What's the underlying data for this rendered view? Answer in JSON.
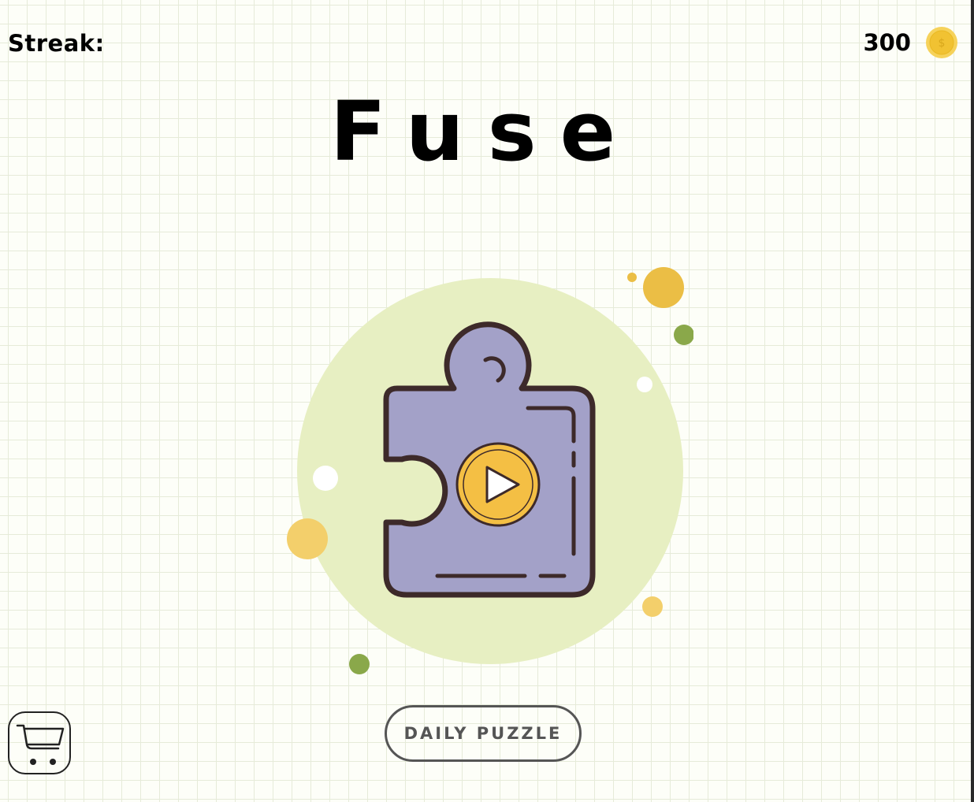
{
  "header": {
    "streak_label": "Streak:",
    "coins": "300",
    "coin_icon": "gold-coin-icon"
  },
  "title": "Fuse",
  "play": {
    "icon": "puzzle-piece-play-icon",
    "circle_color": "#e7efc2",
    "piece_color": "#a3a1c8",
    "play_color": "#f4bf44"
  },
  "buttons": {
    "daily_puzzle": "DAILY PUZZLE",
    "shop_icon": "shopping-cart-icon"
  }
}
